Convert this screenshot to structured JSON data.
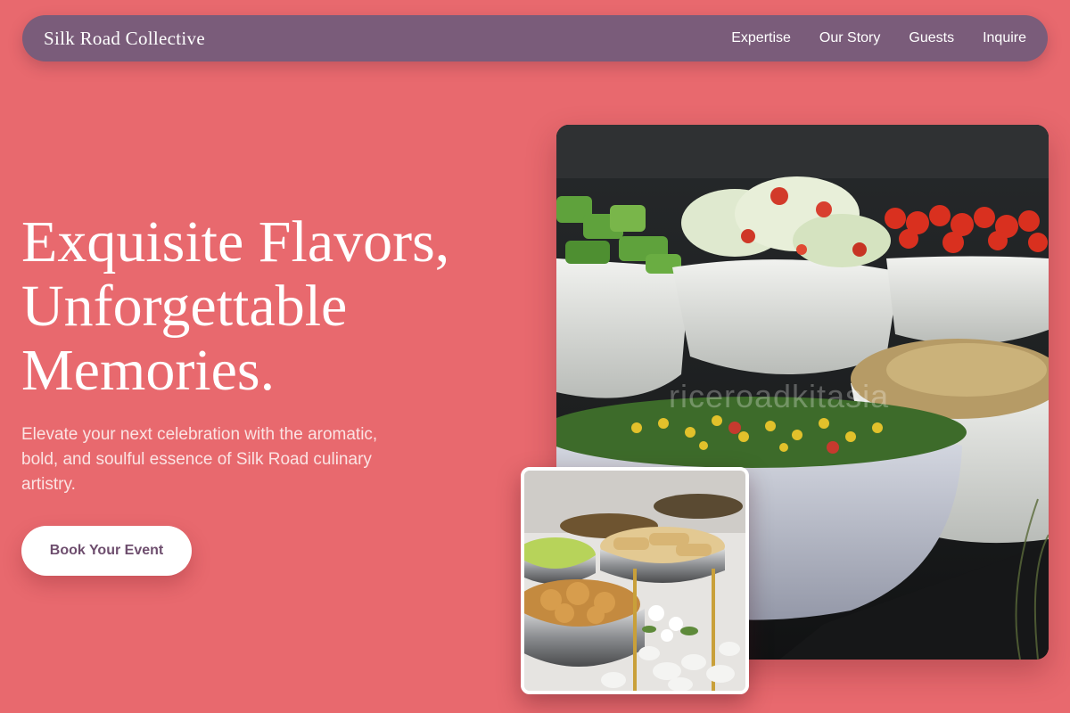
{
  "nav": {
    "brand": "Silk Road Collective",
    "links": [
      {
        "label": "Expertise"
      },
      {
        "label": "Our Story"
      },
      {
        "label": "Guests"
      },
      {
        "label": "Inquire"
      }
    ]
  },
  "hero": {
    "headline_lines": [
      "Exquisite Flavors,",
      "Unforgettable",
      "Memories."
    ],
    "subtitle": "Elevate your next celebration with the aromatic, bold, and soulful essence of Silk Road culinary artistry.",
    "cta_label": "Book Your Event"
  },
  "images": {
    "main_watermark": "riceroadkitasia"
  },
  "colors": {
    "background": "#e8696e",
    "nav": "#7a5c7a",
    "button_text": "#6e4e6e"
  }
}
